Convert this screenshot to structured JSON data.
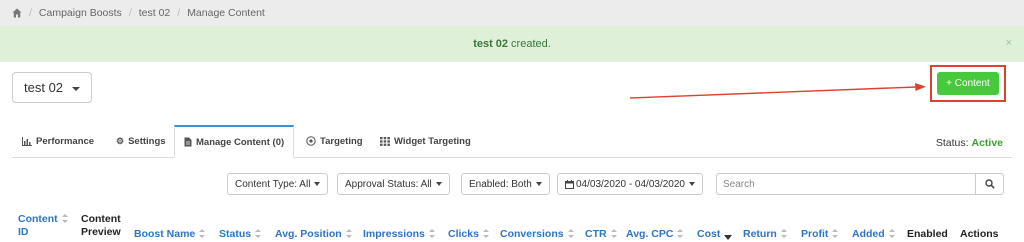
{
  "breadcrumb": {
    "items": [
      "Campaign Boosts",
      "test 02",
      "Manage Content"
    ],
    "separator": "/"
  },
  "alert": {
    "name": "test 02",
    "message": "created.",
    "close": "×"
  },
  "campaign_select": {
    "value": "test 02"
  },
  "content_button": {
    "label": "+ Content"
  },
  "tabs": [
    {
      "label": "Performance",
      "icon": "bar-chart-icon"
    },
    {
      "label": "Settings",
      "icon": "gear-icon"
    },
    {
      "label": "Manage Content (0)",
      "icon": "file-icon"
    },
    {
      "label": "Targeting",
      "icon": "target-icon"
    },
    {
      "label": "Widget Targeting",
      "icon": "grid-icon"
    }
  ],
  "status": {
    "label": "Status:",
    "value": "Active"
  },
  "filters": {
    "content_type": "Content Type: All",
    "approval_status": "Approval Status: All",
    "enabled": "Enabled: Both",
    "date_range": "04/03/2020 - 04/03/2020",
    "search_placeholder": "Search"
  },
  "columns": {
    "content_id_1": "Content",
    "content_id_2": "ID",
    "content_preview_1": "Content",
    "content_preview_2": "Preview",
    "boost_name": "Boost Name",
    "status": "Status",
    "avg_position": "Avg. Position",
    "impressions": "Impressions",
    "clicks": "Clicks",
    "conversions": "Conversions",
    "ctr": "CTR",
    "avg_cpc": "Avg. CPC",
    "cost": "Cost",
    "return": "Return",
    "profit": "Profit",
    "added": "Added",
    "enabled": "Enabled",
    "actions": "Actions"
  },
  "colors": {
    "accent": "#2d75c2",
    "success": "#46c93b",
    "alert_bg": "#def0d8",
    "highlight": "#e0412f"
  }
}
